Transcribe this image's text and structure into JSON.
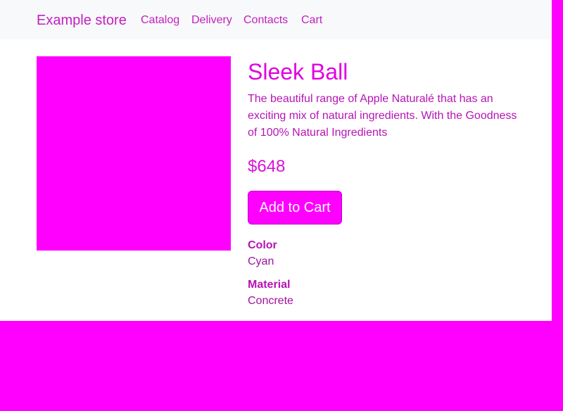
{
  "navbar": {
    "brand": "Example store",
    "links": [
      "Catalog",
      "Delivery",
      "Contacts",
      "Cart"
    ]
  },
  "product": {
    "title": "Sleek Ball",
    "description": "The beautiful range of Apple Naturalé that has an exciting mix of natural ingredients. With the Goodness of 100% Natural Ingredients",
    "price": "$648",
    "add_to_cart_label": "Add to Cart",
    "attributes": [
      {
        "name": "Color",
        "value": "Cyan"
      },
      {
        "name": "Material",
        "value": "Concrete"
      }
    ]
  },
  "colors": {
    "accent": "#ff00ff",
    "navbar_bg": "#f8f9fa",
    "page_bg": "#ffffff"
  }
}
